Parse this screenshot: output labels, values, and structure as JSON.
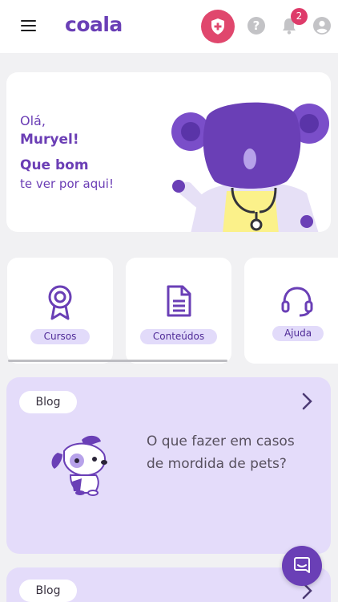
{
  "header": {
    "logo": "coala",
    "notification_count": "2",
    "help_symbol": "?"
  },
  "hero": {
    "greeting": "Olá,",
    "name": "Muryel!",
    "line1": "Que bom",
    "line2": "te ver por aqui!"
  },
  "shortcuts": [
    {
      "label": "Cursos",
      "icon": "award-icon"
    },
    {
      "label": "Conteúdos",
      "icon": "document-icon"
    },
    {
      "label": "Ajuda",
      "icon": "headset-icon"
    }
  ],
  "blog": [
    {
      "tag": "Blog",
      "title": "O que fazer em casos de mordida de pets?"
    },
    {
      "tag": "Blog"
    }
  ],
  "colors": {
    "brand_purple": "#6a3fb6",
    "accent_pink": "#e0476d",
    "blog_bg": "#e4dcfa"
  }
}
